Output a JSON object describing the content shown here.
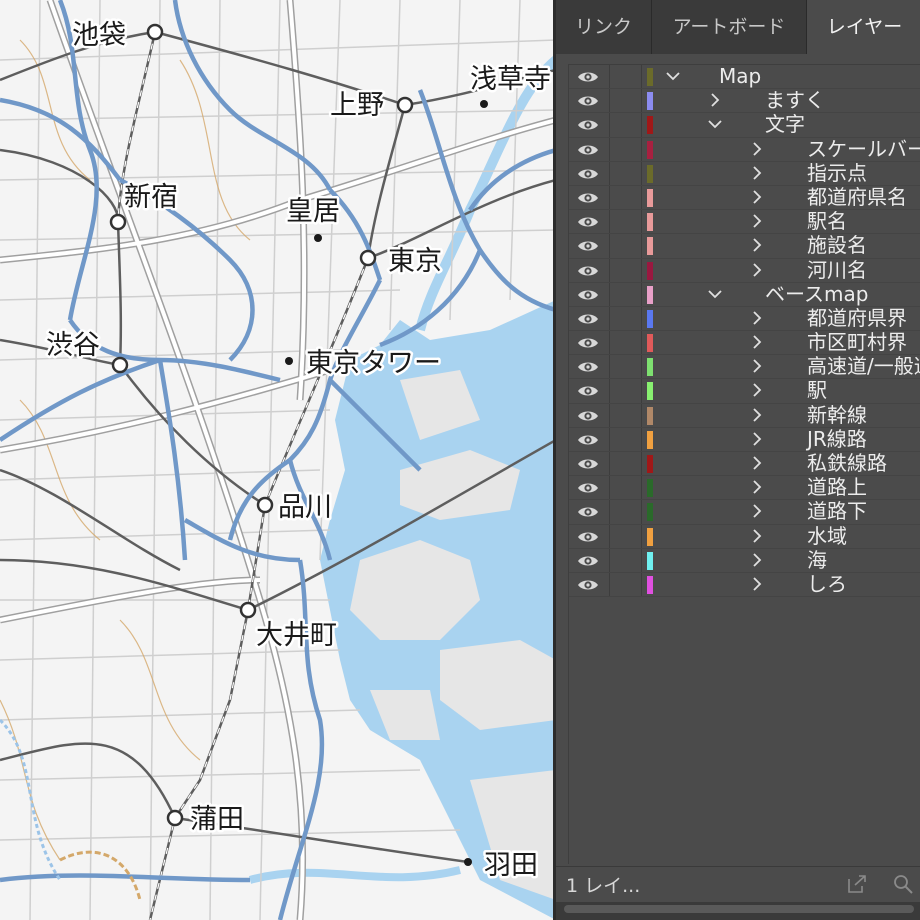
{
  "map": {
    "labels": {
      "ikebukuro": "池袋",
      "asakusa": "浅草寺",
      "ueno": "上野",
      "shinjuku": "新宿",
      "kokyo": "皇居",
      "tokyo": "東京",
      "shibuya": "渋谷",
      "tokyo_tower": "東京タワー",
      "shinagawa": "品川",
      "oimachi": "大井町",
      "kamata": "蒲田",
      "haneda": "羽田"
    },
    "colors": {
      "land": "#f4f4f4",
      "water": "#a9d3f0",
      "ward_boundary": "#7098c8",
      "rail": "#5e5e5e",
      "road": "#b9b9b9",
      "orange_road": "#d4a86a"
    }
  },
  "panel": {
    "tabs": [
      {
        "label": "リンク",
        "active": false
      },
      {
        "label": "アートボード",
        "active": false
      },
      {
        "label": "レイヤー",
        "active": true
      }
    ],
    "layers": [
      {
        "name": "Map",
        "level": 0,
        "expanded": true,
        "color": "#6b6b2a"
      },
      {
        "name": "ますく",
        "level": 1,
        "expanded": false,
        "color": "#8c8cf0"
      },
      {
        "name": "文字",
        "level": 1,
        "expanded": true,
        "color": "#a01818"
      },
      {
        "name": "スケールバー",
        "level": 2,
        "expanded": false,
        "color": "#a82040"
      },
      {
        "name": "指示点",
        "level": 2,
        "expanded": false,
        "color": "#6b6b2a"
      },
      {
        "name": "都道府県名",
        "level": 2,
        "expanded": false,
        "color": "#e89a9a"
      },
      {
        "name": "駅名",
        "level": 2,
        "expanded": false,
        "color": "#e89a9a"
      },
      {
        "name": "施設名",
        "level": 2,
        "expanded": false,
        "color": "#e89a9a"
      },
      {
        "name": "河川名",
        "level": 2,
        "expanded": false,
        "color": "#9a1840"
      },
      {
        "name": "ベースmap",
        "level": 1,
        "expanded": true,
        "color": "#e8a0c8"
      },
      {
        "name": "都道府県界",
        "level": 2,
        "expanded": false,
        "color": "#5a78f0"
      },
      {
        "name": "市区町村界",
        "level": 2,
        "expanded": false,
        "color": "#e05a5a"
      },
      {
        "name": "高速道/一般道",
        "level": 2,
        "expanded": false,
        "color": "#7ee070"
      },
      {
        "name": "駅",
        "level": 2,
        "expanded": false,
        "color": "#88f070"
      },
      {
        "name": "新幹線",
        "level": 2,
        "expanded": false,
        "color": "#b08868"
      },
      {
        "name": "JR線路",
        "level": 2,
        "expanded": false,
        "color": "#f0a040"
      },
      {
        "name": "私鉄線路",
        "level": 2,
        "expanded": false,
        "color": "#a01818"
      },
      {
        "name": "道路上",
        "level": 2,
        "expanded": false,
        "color": "#2a6a2a"
      },
      {
        "name": "道路下",
        "level": 2,
        "expanded": false,
        "color": "#2a6a2a"
      },
      {
        "name": "水域",
        "level": 2,
        "expanded": false,
        "color": "#f0a040"
      },
      {
        "name": "海",
        "level": 2,
        "expanded": false,
        "color": "#70f0f0"
      },
      {
        "name": "しろ",
        "level": 2,
        "expanded": false,
        "color": "#e050e0"
      }
    ],
    "footer": {
      "count": "1 レイ..."
    }
  }
}
